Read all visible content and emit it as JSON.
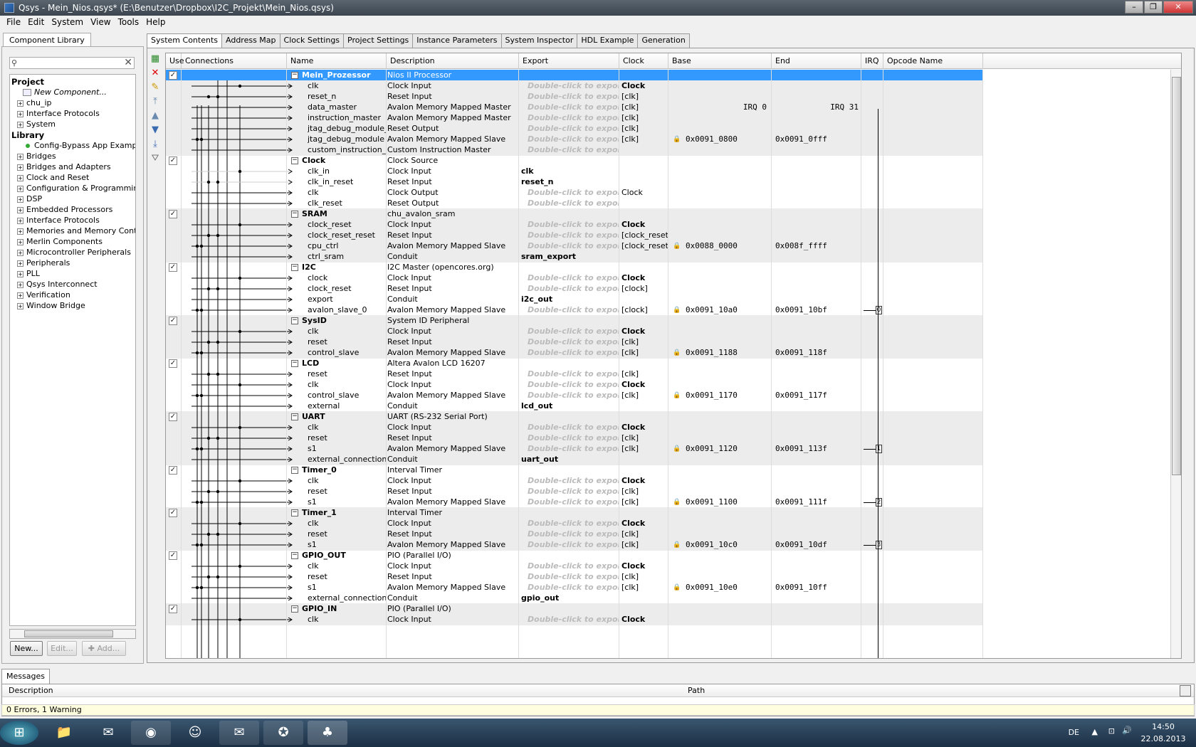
{
  "window": {
    "title": "Qsys - Mein_Nios.qsys* (E:\\Benutzer\\Dropbox\\I2C_Projekt\\Mein_Nios.qsys)"
  },
  "menu": [
    "File",
    "Edit",
    "System",
    "View",
    "Tools",
    "Help"
  ],
  "library": {
    "tab": "Component Library",
    "tree": [
      {
        "label": "Project",
        "kind": "head",
        "indent": 0
      },
      {
        "label": "New Component...",
        "kind": "newcomp",
        "indent": 2
      },
      {
        "label": "chu_ip",
        "kind": "folder",
        "indent": 1
      },
      {
        "label": "Interface Protocols",
        "kind": "folder",
        "indent": 1
      },
      {
        "label": "System",
        "kind": "folder",
        "indent": 1
      },
      {
        "label": "Library",
        "kind": "head",
        "indent": 0
      },
      {
        "label": "Config-Bypass App Exampl",
        "kind": "leaf",
        "indent": 2
      },
      {
        "label": "Bridges",
        "kind": "folder",
        "indent": 1
      },
      {
        "label": "Bridges and Adapters",
        "kind": "folder",
        "indent": 1
      },
      {
        "label": "Clock and Reset",
        "kind": "folder",
        "indent": 1
      },
      {
        "label": "Configuration & Programming",
        "kind": "folder",
        "indent": 1
      },
      {
        "label": "DSP",
        "kind": "folder",
        "indent": 1
      },
      {
        "label": "Embedded Processors",
        "kind": "folder",
        "indent": 1
      },
      {
        "label": "Interface Protocols",
        "kind": "folder",
        "indent": 1
      },
      {
        "label": "Memories and Memory Controlle",
        "kind": "folder",
        "indent": 1
      },
      {
        "label": "Merlin Components",
        "kind": "folder",
        "indent": 1
      },
      {
        "label": "Microcontroller Peripherals",
        "kind": "folder",
        "indent": 1
      },
      {
        "label": "Peripherals",
        "kind": "folder",
        "indent": 1
      },
      {
        "label": "PLL",
        "kind": "folder",
        "indent": 1
      },
      {
        "label": "Qsys Interconnect",
        "kind": "folder",
        "indent": 1
      },
      {
        "label": "Verification",
        "kind": "folder",
        "indent": 1
      },
      {
        "label": "Window Bridge",
        "kind": "folder",
        "indent": 1
      }
    ],
    "buttons": {
      "new": "New...",
      "edit": "Edit...",
      "add": "Add..."
    }
  },
  "tabs": [
    "System Contents",
    "Address Map",
    "Clock Settings",
    "Project Settings",
    "Instance Parameters",
    "System Inspector",
    "HDL Example",
    "Generation"
  ],
  "columns": [
    "Use",
    "Connections",
    "Name",
    "Description",
    "Export",
    "Clock",
    "Base",
    "End",
    "IRQ",
    "Opcode Name"
  ],
  "export_placeholder": "Double-click to export",
  "rows": [
    {
      "t": "c",
      "name": "Mein_Prozessor",
      "desc": "Nios II Processor",
      "sel": true
    },
    {
      "t": "i",
      "name": "clk",
      "desc": "Clock Input",
      "export": "",
      "clock": "Clock",
      "cb": true
    },
    {
      "t": "i",
      "name": "reset_n",
      "desc": "Reset Input",
      "export": "",
      "clock": "[clk]"
    },
    {
      "t": "i",
      "name": "data_master",
      "desc": "Avalon Memory Mapped Master",
      "export": "",
      "clock": "[clk]",
      "base": "IRQ 0",
      "end": "IRQ 31",
      "irqtxt": true
    },
    {
      "t": "i",
      "name": "instruction_master",
      "desc": "Avalon Memory Mapped Master",
      "export": "",
      "clock": "[clk]"
    },
    {
      "t": "i",
      "name": "jtag_debug_module_re...",
      "desc": "Reset Output",
      "export": "",
      "clock": "[clk]"
    },
    {
      "t": "i",
      "name": "jtag_debug_module",
      "desc": "Avalon Memory Mapped Slave",
      "export": "",
      "clock": "[clk]",
      "base": "0x0091_0800",
      "end": "0x0091_0fff"
    },
    {
      "t": "i",
      "name": "custom_instruction_m...",
      "desc": "Custom Instruction Master",
      "export": ""
    },
    {
      "t": "c",
      "name": "Clock",
      "desc": "Clock Source"
    },
    {
      "t": "i",
      "name": "clk_in",
      "desc": "Clock Input",
      "export": "clk"
    },
    {
      "t": "i",
      "name": "clk_in_reset",
      "desc": "Reset Input",
      "export": "reset_n"
    },
    {
      "t": "i",
      "name": "clk",
      "desc": "Clock Output",
      "export": "",
      "clock": "Clock",
      "cn": true
    },
    {
      "t": "i",
      "name": "clk_reset",
      "desc": "Reset Output",
      "export": ""
    },
    {
      "t": "c",
      "name": "SRAM",
      "desc": "chu_avalon_sram"
    },
    {
      "t": "i",
      "name": "clock_reset",
      "desc": "Clock Input",
      "export": "",
      "clock": "Clock",
      "cb": true
    },
    {
      "t": "i",
      "name": "clock_reset_reset",
      "desc": "Reset Input",
      "export": "",
      "clock": "[clock_reset]"
    },
    {
      "t": "i",
      "name": "cpu_ctrl",
      "desc": "Avalon Memory Mapped Slave",
      "export": "",
      "clock": "[clock_reset]",
      "base": "0x0088_0000",
      "end": "0x008f_ffff"
    },
    {
      "t": "i",
      "name": "ctrl_sram",
      "desc": "Conduit",
      "export": "sram_export"
    },
    {
      "t": "c",
      "name": "I2C",
      "desc": "I2C Master (opencores.org)"
    },
    {
      "t": "i",
      "name": "clock",
      "desc": "Clock Input",
      "export": "",
      "clock": "Clock",
      "cb": true
    },
    {
      "t": "i",
      "name": "clock_reset",
      "desc": "Reset Input",
      "export": "",
      "clock": "[clock]"
    },
    {
      "t": "i",
      "name": "export",
      "desc": "Conduit",
      "export": "i2c_out"
    },
    {
      "t": "i",
      "name": "avalon_slave_0",
      "desc": "Avalon Memory Mapped Slave",
      "export": "",
      "clock": "[clock]",
      "base": "0x0091_10a0",
      "end": "0x0091_10bf",
      "irq": "0"
    },
    {
      "t": "c",
      "name": "SysID",
      "desc": "System ID Peripheral"
    },
    {
      "t": "i",
      "name": "clk",
      "desc": "Clock Input",
      "export": "",
      "clock": "Clock",
      "cb": true
    },
    {
      "t": "i",
      "name": "reset",
      "desc": "Reset Input",
      "export": "",
      "clock": "[clk]"
    },
    {
      "t": "i",
      "name": "control_slave",
      "desc": "Avalon Memory Mapped Slave",
      "export": "",
      "clock": "[clk]",
      "base": "0x0091_1188",
      "end": "0x0091_118f"
    },
    {
      "t": "c",
      "name": "LCD",
      "desc": "Altera Avalon LCD 16207"
    },
    {
      "t": "i",
      "name": "reset",
      "desc": "Reset Input",
      "export": "",
      "clock": "[clk]"
    },
    {
      "t": "i",
      "name": "clk",
      "desc": "Clock Input",
      "export": "",
      "clock": "Clock",
      "cb": true
    },
    {
      "t": "i",
      "name": "control_slave",
      "desc": "Avalon Memory Mapped Slave",
      "export": "",
      "clock": "[clk]",
      "base": "0x0091_1170",
      "end": "0x0091_117f"
    },
    {
      "t": "i",
      "name": "external",
      "desc": "Conduit",
      "export": "lcd_out"
    },
    {
      "t": "c",
      "name": "UART",
      "desc": "UART (RS-232 Serial Port)"
    },
    {
      "t": "i",
      "name": "clk",
      "desc": "Clock Input",
      "export": "",
      "clock": "Clock",
      "cb": true
    },
    {
      "t": "i",
      "name": "reset",
      "desc": "Reset Input",
      "export": "",
      "clock": "[clk]"
    },
    {
      "t": "i",
      "name": "s1",
      "desc": "Avalon Memory Mapped Slave",
      "export": "",
      "clock": "[clk]",
      "base": "0x0091_1120",
      "end": "0x0091_113f",
      "irq": "1"
    },
    {
      "t": "i",
      "name": "external_connection",
      "desc": "Conduit",
      "export": "uart_out"
    },
    {
      "t": "c",
      "name": "Timer_0",
      "desc": "Interval Timer"
    },
    {
      "t": "i",
      "name": "clk",
      "desc": "Clock Input",
      "export": "",
      "clock": "Clock",
      "cb": true
    },
    {
      "t": "i",
      "name": "reset",
      "desc": "Reset Input",
      "export": "",
      "clock": "[clk]"
    },
    {
      "t": "i",
      "name": "s1",
      "desc": "Avalon Memory Mapped Slave",
      "export": "",
      "clock": "[clk]",
      "base": "0x0091_1100",
      "end": "0x0091_111f",
      "irq": "2"
    },
    {
      "t": "c",
      "name": "Timer_1",
      "desc": "Interval Timer"
    },
    {
      "t": "i",
      "name": "clk",
      "desc": "Clock Input",
      "export": "",
      "clock": "Clock",
      "cb": true
    },
    {
      "t": "i",
      "name": "reset",
      "desc": "Reset Input",
      "export": "",
      "clock": "[clk]"
    },
    {
      "t": "i",
      "name": "s1",
      "desc": "Avalon Memory Mapped Slave",
      "export": "",
      "clock": "[clk]",
      "base": "0x0091_10c0",
      "end": "0x0091_10df",
      "irq": "3"
    },
    {
      "t": "c",
      "name": "GPIO_OUT",
      "desc": "PIO (Parallel I/O)"
    },
    {
      "t": "i",
      "name": "clk",
      "desc": "Clock Input",
      "export": "",
      "clock": "Clock",
      "cb": true
    },
    {
      "t": "i",
      "name": "reset",
      "desc": "Reset Input",
      "export": "",
      "clock": "[clk]"
    },
    {
      "t": "i",
      "name": "s1",
      "desc": "Avalon Memory Mapped Slave",
      "export": "",
      "clock": "[clk]",
      "base": "0x0091_10e0",
      "end": "0x0091_10ff"
    },
    {
      "t": "i",
      "name": "external_connection",
      "desc": "Conduit",
      "export": "gpio_out"
    },
    {
      "t": "c",
      "name": "GPIO_IN",
      "desc": "PIO (Parallel I/O)"
    },
    {
      "t": "i",
      "name": "clk",
      "desc": "Clock Input",
      "export": "",
      "clock": "Clock",
      "cb": true
    }
  ],
  "messages": {
    "tab": "Messages",
    "col_description": "Description",
    "col_path": "Path",
    "status": "0 Errors, 1 Warning"
  },
  "tray": {
    "lang": "DE",
    "time": "14:50",
    "date": "22.08.2013"
  }
}
